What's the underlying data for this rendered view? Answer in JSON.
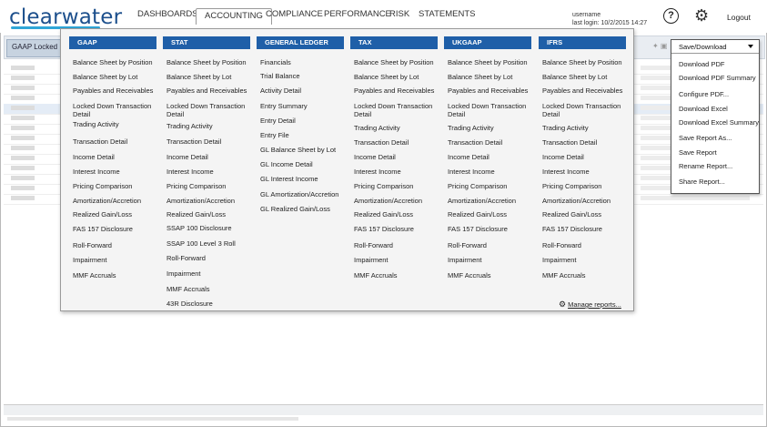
{
  "app": {
    "logo_text": "clearwater"
  },
  "nav": {
    "dashboards": "DASHBOARDS",
    "accounting": "ACCOUNTING",
    "compliance": "COMPLIANCE",
    "performance": "PERFORMANCE",
    "risk": "RISK",
    "statements": "STATEMENTS"
  },
  "user": {
    "username": "username",
    "last_login": "last login: 10/2/2015 14:27"
  },
  "header": {
    "help_glyph": "?",
    "logout_label": "Logout"
  },
  "report_tab": {
    "label": "GAAP Locked Do"
  },
  "menu": {
    "columns": [
      {
        "header": "GAAP",
        "items": [
          "Balance Sheet by Position",
          "Balance Sheet by Lot",
          "Payables and Receivables",
          "Locked Down Transaction Detail",
          "Trading Activity",
          "Transaction Detail",
          "Income Detail",
          "Interest Income",
          "Pricing Comparison",
          "Amortization/Accretion",
          "Realized Gain/Loss",
          "FAS 157 Disclosure",
          "Roll-Forward",
          "Impairment",
          "MMF Accruals"
        ]
      },
      {
        "header": "STAT",
        "items": [
          "Balance Sheet by Position",
          "Balance Sheet by Lot",
          "Payables and Receivables",
          "Locked Down Transaction Detail",
          "Trading Activity",
          "Transaction Detail",
          "Income Detail",
          "Interest Income",
          "Pricing Comparison",
          "Amortization/Accretion",
          "Realized Gain/Loss",
          "SSAP 100 Disclosure",
          "SSAP 100 Level 3 Roll",
          "Roll-Forward",
          "Impairment",
          "MMF Accruals",
          "43R Disclosure"
        ]
      },
      {
        "header": "GENERAL LEDGER",
        "items": [
          "Financials",
          "Trial Balance",
          "Activity Detail",
          "Entry Summary",
          "Entry Detail",
          "Entry File",
          "GL Balance Sheet by Lot",
          "GL Income Detail",
          "GL Interest Income",
          "GL Amortization/Accretion",
          "GL Realized Gain/Loss"
        ]
      },
      {
        "header": "TAX",
        "items": [
          "Balance Sheet by Position",
          "Balance Sheet by Lot",
          "Payables and Receivables",
          "Locked Down Transaction Detail",
          "Trading Activity",
          "Transaction Detail",
          "Income Detail",
          "Interest Income",
          "Pricing Comparison",
          "Amortization/Accretion",
          "Realized Gain/Loss",
          "FAS 157 Disclosure",
          "Roll-Forward",
          "Impairment",
          "MMF Accruals"
        ]
      },
      {
        "header": "UKGAAP",
        "items": [
          "Balance Sheet by Position",
          "Balance Sheet by Lot",
          "Payables and Receivables",
          "Locked Down Transaction Detail",
          "Trading Activity",
          "Transaction Detail",
          "Income Detail",
          "Interest Income",
          "Pricing Comparison",
          "Amortization/Accretion",
          "Realized Gain/Loss",
          "FAS 157 Disclosure",
          "Roll-Forward",
          "Impairment",
          "MMF Accruals"
        ]
      },
      {
        "header": "IFRS",
        "items": [
          "Balance Sheet by Position",
          "Balance Sheet by Lot",
          "Payables and Receivables",
          "Locked Down Transaction Detail",
          "Trading Activity",
          "Transaction Detail",
          "Income Detail",
          "Interest Income",
          "Pricing Comparison",
          "Amortization/Accretion",
          "Realized Gain/Loss",
          "FAS 157 Disclosure",
          "Roll-Forward",
          "Impairment",
          "MMF Accruals"
        ]
      }
    ],
    "manage_label": "Manage reports..."
  },
  "save_menu": {
    "title": "Save/Download",
    "items": [
      "Download PDF",
      "Download PDF Summary",
      "Configure PDF...",
      "Download Excel",
      "Download Excel Summary",
      "Save Report As...",
      "Save Report",
      "Rename Report...",
      "Share Report..."
    ]
  }
}
